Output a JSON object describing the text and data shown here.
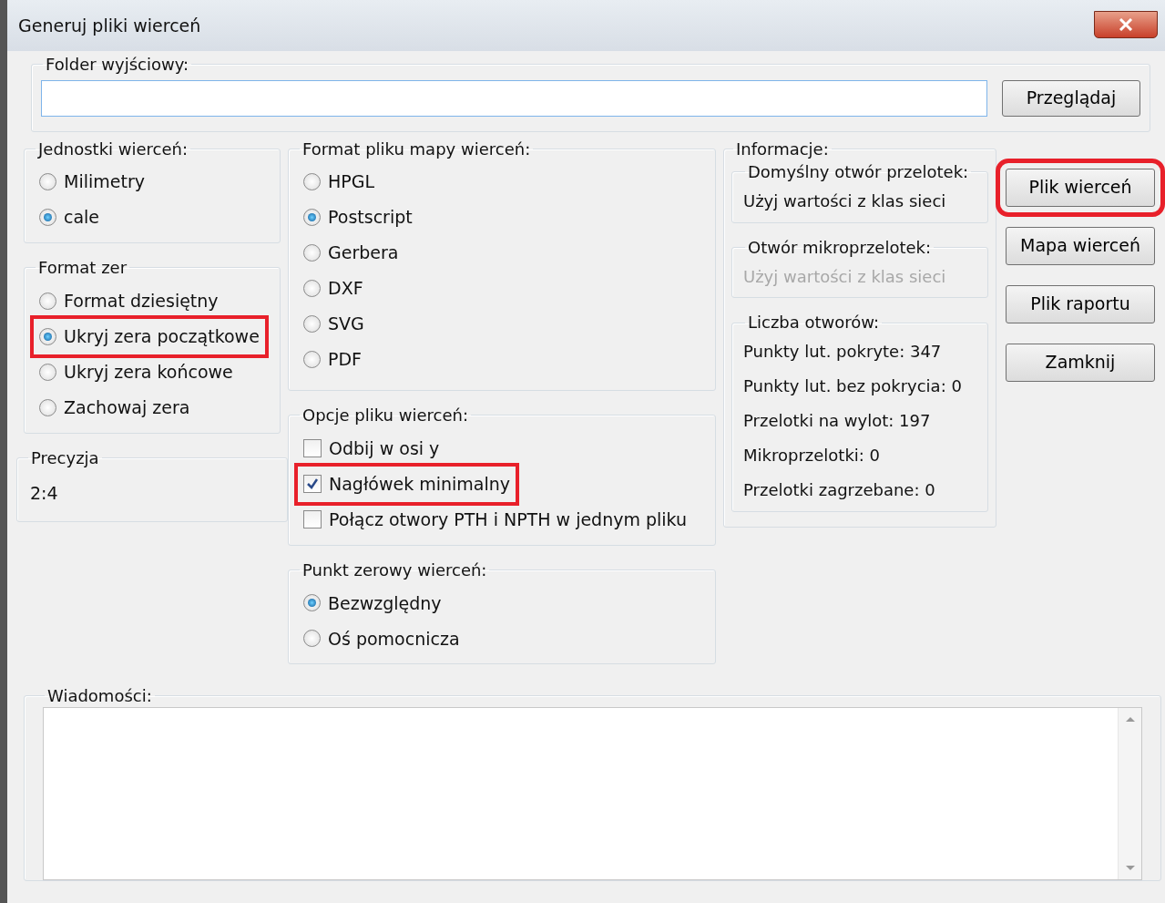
{
  "window": {
    "title": "Generuj pliki wierceń"
  },
  "output_folder": {
    "label": "Folder wyjściowy:",
    "browse_button": "Przeglądaj"
  },
  "drill_units": {
    "label": "Jednostki wierceń:",
    "options": [
      {
        "label": "Milimetry",
        "selected": false,
        "highlighted": false
      },
      {
        "label": "cale",
        "selected": true,
        "highlighted": false
      }
    ]
  },
  "zeros_format": {
    "label": "Format zer",
    "options": [
      {
        "label": "Format dziesiętny",
        "selected": false,
        "highlighted": false
      },
      {
        "label": "Ukryj zera początkowe",
        "selected": true,
        "highlighted": true
      },
      {
        "label": "Ukryj zera końcowe",
        "selected": false,
        "highlighted": false
      },
      {
        "label": "Zachowaj zera",
        "selected": false,
        "highlighted": false
      }
    ]
  },
  "precision": {
    "label": "Precyzja",
    "value": "2:4"
  },
  "map_format": {
    "label": "Format pliku mapy wierceń:",
    "options": [
      {
        "label": "HPGL",
        "selected": false,
        "highlighted": false
      },
      {
        "label": "Postscript",
        "selected": true,
        "highlighted": false
      },
      {
        "label": "Gerbera",
        "selected": false,
        "highlighted": false
      },
      {
        "label": "DXF",
        "selected": false,
        "highlighted": false
      },
      {
        "label": "SVG",
        "selected": false,
        "highlighted": false
      },
      {
        "label": "PDF",
        "selected": false,
        "highlighted": false
      }
    ]
  },
  "drill_options": {
    "label": "Opcje pliku wierceń:",
    "options": [
      {
        "label": "Odbij w osi y",
        "checked": false,
        "highlighted": false
      },
      {
        "label": "Nagłówek minimalny",
        "checked": true,
        "highlighted": true
      },
      {
        "label": "Połącz otwory PTH i NPTH w jednym pliku",
        "checked": false,
        "highlighted": false
      }
    ]
  },
  "drill_origin": {
    "label": "Punkt zerowy wierceń:",
    "options": [
      {
        "label": "Bezwzględny",
        "selected": true,
        "highlighted": false
      },
      {
        "label": "Oś pomocnicza",
        "selected": false,
        "highlighted": false
      }
    ]
  },
  "info": {
    "label": "Informacje:",
    "sections": [
      {
        "label": "Domyślny otwór przelotek:",
        "lines": [
          {
            "text": "Użyj wartości z klas sieci",
            "disabled": false
          }
        ]
      },
      {
        "label": "Otwór mikroprzelotek:",
        "lines": [
          {
            "text": "Użyj wartości z klas sieci",
            "disabled": true
          }
        ]
      },
      {
        "label": "Liczba otworów:",
        "lines": [
          {
            "text": "Punkty lut. pokryte: 347",
            "disabled": false
          },
          {
            "text": "Punkty lut. bez pokrycia: 0",
            "disabled": false
          },
          {
            "text": "Przelotki na wylot: 197",
            "disabled": false
          },
          {
            "text": "Mikroprzelotki: 0",
            "disabled": false
          },
          {
            "text": "Przelotki zagrzebane: 0",
            "disabled": false
          }
        ]
      }
    ]
  },
  "buttons": [
    {
      "label": "Plik wierceń",
      "highlighted": true
    },
    {
      "label": "Mapa wierceń",
      "highlighted": false
    },
    {
      "label": "Plik raportu",
      "highlighted": false
    },
    {
      "label": "Zamknij",
      "highlighted": false
    }
  ],
  "messages": {
    "label": "Wiadomości:"
  }
}
